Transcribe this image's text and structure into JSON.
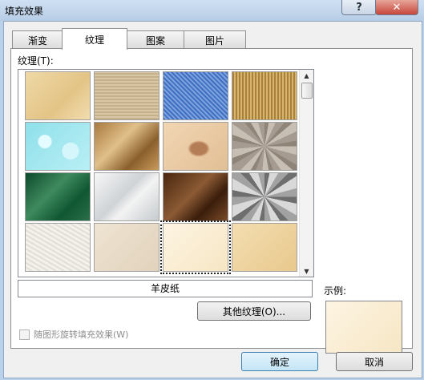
{
  "window": {
    "title": "填充效果",
    "help_label": "?",
    "close_label": "✕"
  },
  "tabs": [
    {
      "label": "渐变",
      "active": false
    },
    {
      "label": "纹理",
      "active": true
    },
    {
      "label": "图案",
      "active": false
    },
    {
      "label": "图片",
      "active": false
    }
  ],
  "texture_panel": {
    "label": "纹理(T):",
    "selected_texture_name": "羊皮纸",
    "other_texture_button": "其他纹理(O)...",
    "rotate_checkbox_label": "随图形旋转填充效果(W)",
    "rotate_checked": false,
    "textures": [
      {
        "icon": "parchment-texture"
      },
      {
        "icon": "canvas-texture"
      },
      {
        "icon": "denim-texture"
      },
      {
        "icon": "woven-mat-texture"
      },
      {
        "icon": "water-droplets-texture"
      },
      {
        "icon": "paper-bag-texture"
      },
      {
        "icon": "fish-fossil-texture"
      },
      {
        "icon": "sand-texture"
      },
      {
        "icon": "green-marble-texture"
      },
      {
        "icon": "white-marble-texture"
      },
      {
        "icon": "brown-marble-texture"
      },
      {
        "icon": "granite-texture"
      },
      {
        "icon": "newsprint-texture"
      },
      {
        "icon": "recycled-paper-texture"
      },
      {
        "icon": "parchment-selected-texture",
        "selected": true
      },
      {
        "icon": "stationery-texture"
      }
    ]
  },
  "preview": {
    "label": "示例:"
  },
  "buttons": {
    "ok": "确定",
    "cancel": "取消"
  }
}
